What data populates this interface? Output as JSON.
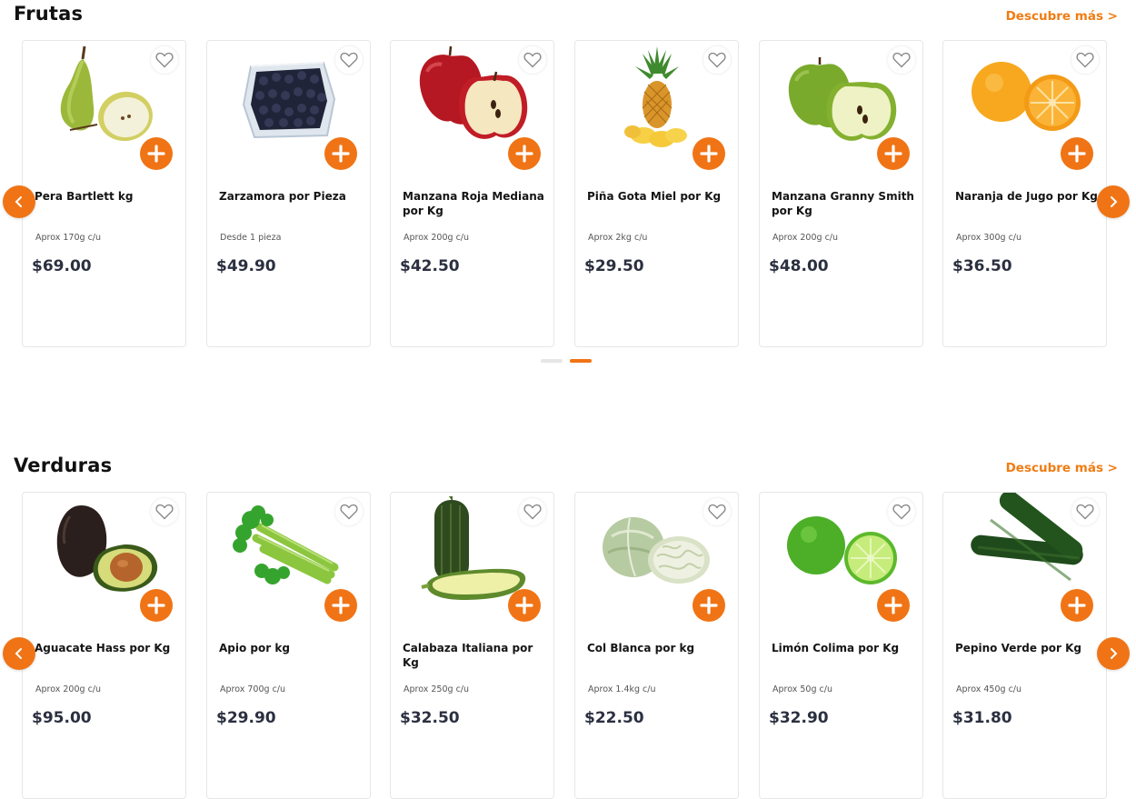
{
  "colors": {
    "accent": "#f07415",
    "link": "#f07c13",
    "price": "#2b3040"
  },
  "sections": [
    {
      "title": "Frutas",
      "more_label": "Descubre más >",
      "products": [
        {
          "name": "Pera Bartlett kg",
          "weight": "Aprox 170g c/u",
          "price": "$69.00",
          "image": "pear"
        },
        {
          "name": "Zarzamora por Pieza",
          "weight": "Desde 1 pieza",
          "price": "$49.90",
          "image": "blackberries"
        },
        {
          "name": "Manzana Roja Mediana por Kg",
          "weight": "Aprox 200g c/u",
          "price": "$42.50",
          "image": "red-apple"
        },
        {
          "name": "Piña Gota Miel por Kg",
          "weight": "Aprox 2kg c/u",
          "price": "$29.50",
          "image": "pineapple"
        },
        {
          "name": "Manzana Granny Smith por Kg",
          "weight": "Aprox 200g c/u",
          "price": "$48.00",
          "image": "green-apple"
        },
        {
          "name": "Naranja de Jugo por Kg",
          "weight": "Aprox 300g c/u",
          "price": "$36.50",
          "image": "orange"
        }
      ]
    },
    {
      "title": "Verduras",
      "more_label": "Descubre más >",
      "products": [
        {
          "name": "Aguacate Hass por Kg",
          "weight": "Aprox 200g c/u",
          "price": "$95.00",
          "image": "avocado"
        },
        {
          "name": "Apio por kg",
          "weight": "Aprox 700g c/u",
          "price": "$29.90",
          "image": "celery"
        },
        {
          "name": "Calabaza Italiana por Kg",
          "weight": "Aprox 250g c/u",
          "price": "$32.50",
          "image": "zucchini"
        },
        {
          "name": "Col Blanca por kg",
          "weight": "Aprox 1.4kg c/u",
          "price": "$22.50",
          "image": "cabbage"
        },
        {
          "name": "Limón Colima por Kg",
          "weight": "Aprox 50g c/u",
          "price": "$32.90",
          "image": "lime"
        },
        {
          "name": "Pepino Verde por Kg",
          "weight": "Aprox 450g c/u",
          "price": "$31.80",
          "image": "cucumber"
        }
      ]
    }
  ],
  "carousel_pager": {
    "page_count": 2,
    "active_page": 2
  }
}
